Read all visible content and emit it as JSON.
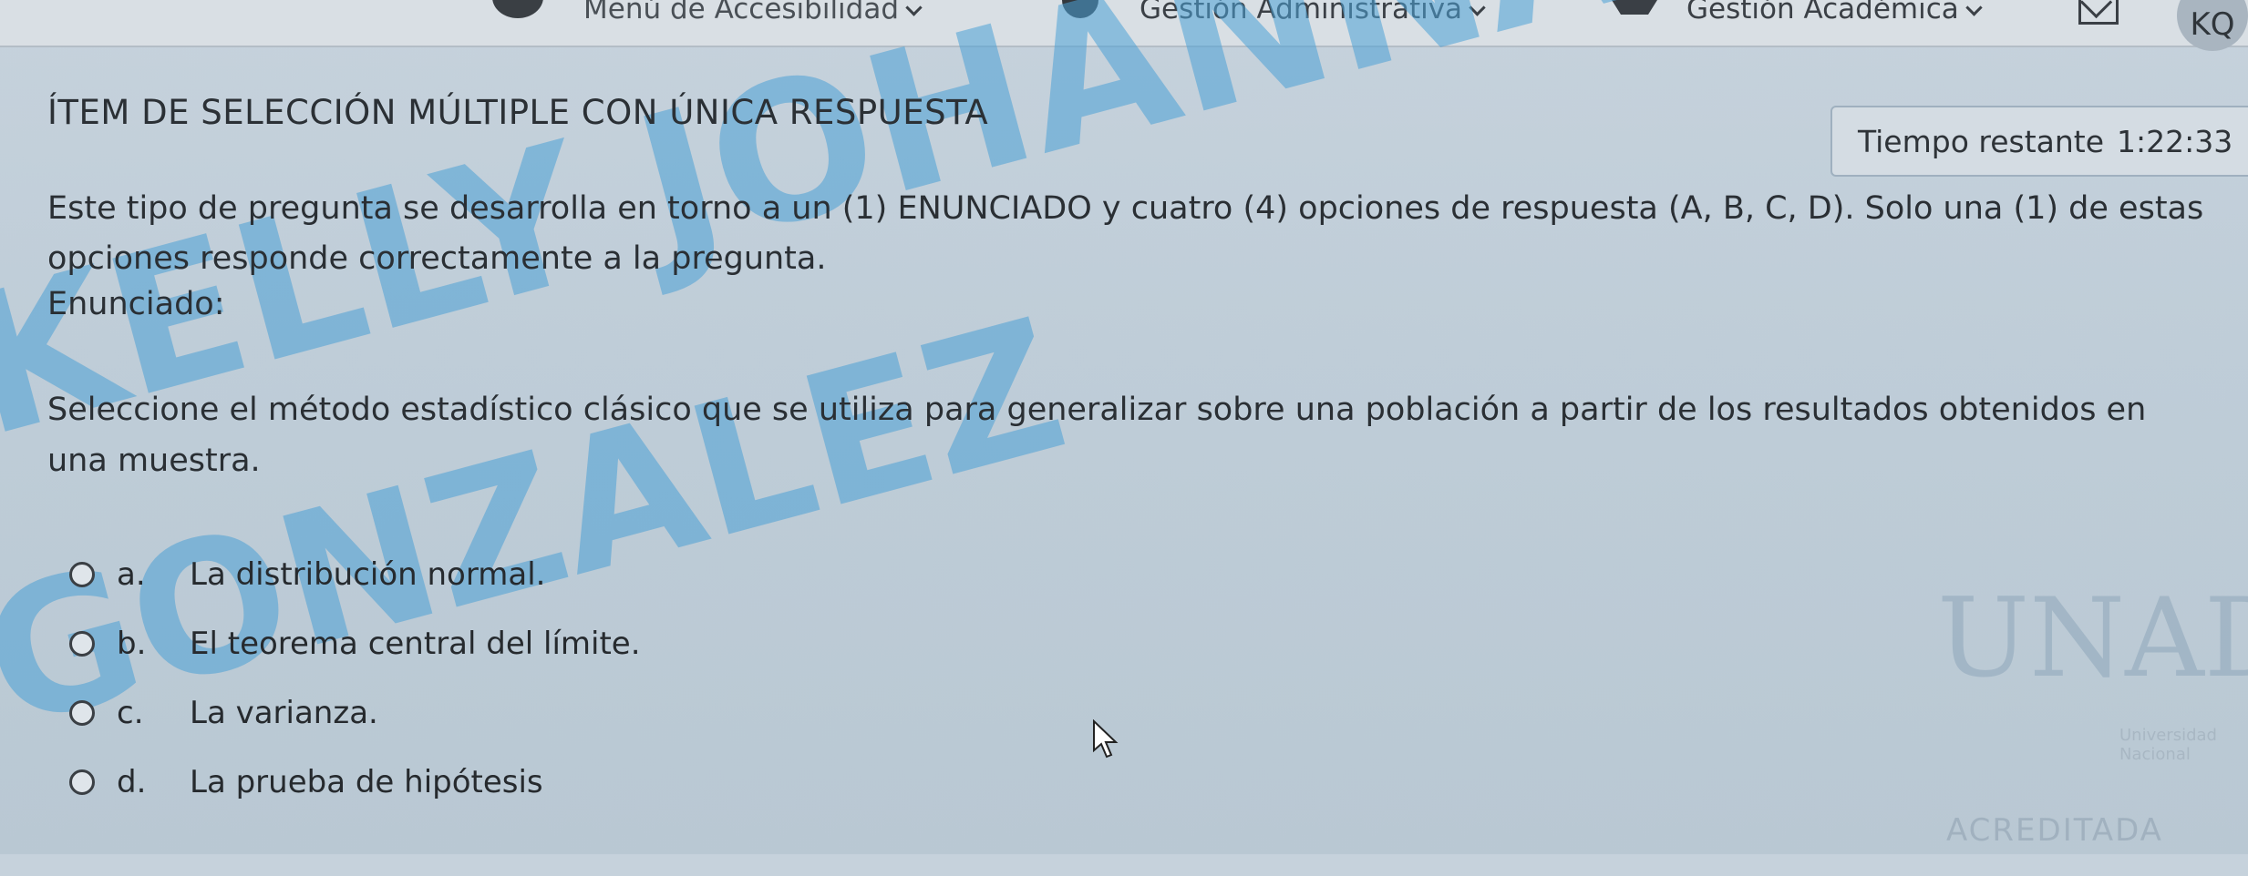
{
  "topbar": {
    "access_menu": "Menú de Accesibilidad",
    "admin_menu": "Gestión Administrativa",
    "academic_menu": "Gestión Académica",
    "user_initials": "KQ"
  },
  "quiz": {
    "title": "ÍTEM DE SELECCIÓN MÚLTIPLE CON ÚNICA RESPUESTA",
    "timer_label": "Tiempo restante",
    "timer_value": "1:22:33",
    "intro": "Este tipo de pregunta se desarrolla en torno a un (1) ENUNCIADO y cuatro (4) opciones de respuesta (A, B, C, D). Solo una (1) de estas opciones responde correctamente a la pregunta.",
    "statement_label": "Enunciado:",
    "question": "Seleccione el método estadístico clásico que se utiliza para generalizar sobre una población a partir de los resultados obtenidos en una muestra.",
    "options": [
      {
        "letter": "a.",
        "text": "La distribución normal."
      },
      {
        "letter": "b.",
        "text": "El teorema central del límite."
      },
      {
        "letter": "c.",
        "text": "La varianza."
      },
      {
        "letter": "d.",
        "text": "La prueba de hipótesis"
      }
    ]
  },
  "watermark": {
    "line1": "KELLY JOHANNA QUINTERO",
    "line2": "GONZALEZ"
  },
  "logo": {
    "mark": "UNAD",
    "subtitle": "Universidad Nacional",
    "badge": "ACREDITADA"
  }
}
